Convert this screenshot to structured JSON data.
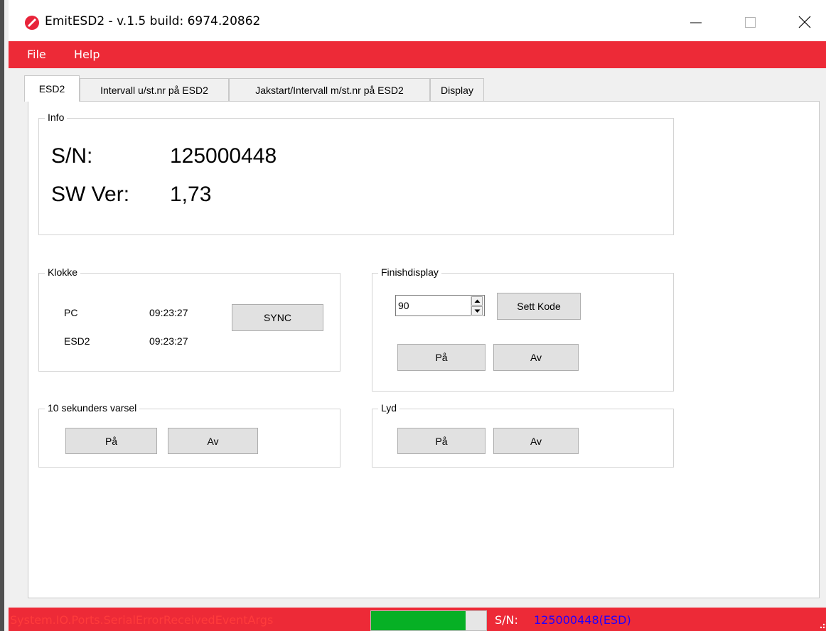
{
  "window": {
    "title": "EmitESD2  - v.1.5   build: 6974.20862",
    "brand_color": "#ed2a37",
    "controls": [
      "minimize-icon",
      "maximize-icon",
      "close-icon"
    ]
  },
  "menu": {
    "items": [
      "File",
      "Help"
    ]
  },
  "tabs": [
    {
      "label": "ESD2",
      "active": true
    },
    {
      "label": "Intervall u/st.nr på ESD2",
      "active": false
    },
    {
      "label": "Jakstart/Intervall m/st.nr på ESD2",
      "active": false
    },
    {
      "label": "Display",
      "active": false
    }
  ],
  "info": {
    "title": "Info",
    "sn_label": "S/N:",
    "sn_value": "125000448",
    "sw_label": "SW Ver:",
    "sw_value": "1,73"
  },
  "klokke": {
    "title": "Klokke",
    "pc_label": "PC",
    "pc_time": "09:23:27",
    "esd_label": "ESD2",
    "esd_time": "09:23:27",
    "sync_button": "SYNC"
  },
  "finishdisplay": {
    "title": "Finishdisplay",
    "code_value": "90",
    "sett_kode_button": "Sett Kode",
    "on_button": "På",
    "off_button": "Av"
  },
  "varsel": {
    "title": "10 sekunders varsel",
    "on_button": "På",
    "off_button": "Av"
  },
  "lyd": {
    "title": "Lyd",
    "on_button": "På",
    "off_button": "Av"
  },
  "status": {
    "message": "System.IO.Ports.SerialErrorReceivedEventArgs",
    "message_color": "#ff3b3b",
    "progress_fraction": 0.82,
    "progress_color": "#06b025",
    "sn_label": "S/N:",
    "sn_value": "125000448(ESD)"
  }
}
